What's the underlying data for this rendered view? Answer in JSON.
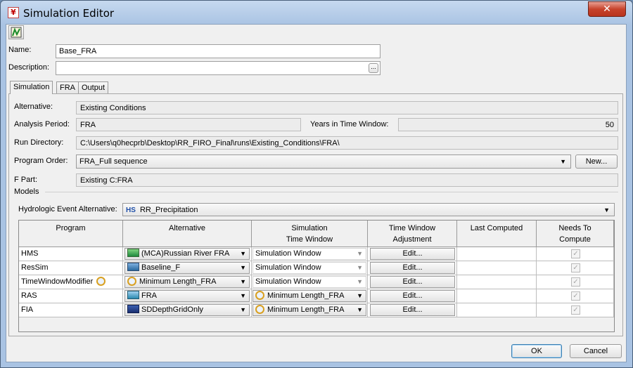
{
  "window": {
    "title": "Simulation Editor",
    "close_label": "✕"
  },
  "form": {
    "name_label": "Name:",
    "name_value": "Base_FRA",
    "description_label": "Description:",
    "description_value": "",
    "browse_label": "..."
  },
  "tabs": [
    {
      "label": "Simulation"
    },
    {
      "label": "FRA"
    },
    {
      "label": "Output"
    }
  ],
  "simulation": {
    "alternative_label": "Alternative:",
    "alternative_value": "Existing Conditions",
    "analysis_period_label": "Analysis Period:",
    "analysis_period_value": "FRA",
    "years_label": "Years in Time Window:",
    "years_value": "50",
    "run_directory_label": "Run Directory:",
    "run_directory_value": "C:\\Users\\q0hecprb\\Desktop\\RR_FIRO_Final\\runs\\Existing_Conditions\\FRA\\",
    "program_order_label": "Program Order:",
    "program_order_value": "FRA_Full sequence",
    "new_button": "New...",
    "fpart_label": "F Part:",
    "fpart_value": "Existing C:FRA",
    "models_label": "Models",
    "hydro_label": "Hydrologic Event Alternative:",
    "hydro_icon_text": "HS",
    "hydro_value": "RR_Precipitation"
  },
  "table": {
    "headers": {
      "program": "Program",
      "alternative": "Alternative",
      "sim_tw_1": "Simulation",
      "sim_tw_2": "Time Window",
      "twa_1": "Time Window",
      "twa_2": "Adjustment",
      "last_computed": "Last Computed",
      "needs_1": "Needs To",
      "needs_2": "Compute"
    },
    "rows": [
      {
        "program": "HMS",
        "alternative": "(MCA)Russian River FRA",
        "time_window": "Simulation Window",
        "adjust": "Edit...",
        "last": "",
        "needs": "✓"
      },
      {
        "program": "ResSim",
        "alternative": "Baseline_F",
        "time_window": "Simulation Window",
        "adjust": "Edit...",
        "last": "",
        "needs": "✓"
      },
      {
        "program": "TimeWindowModifier",
        "alternative": "Minimum Length_FRA",
        "time_window": "Simulation Window",
        "adjust": "Edit...",
        "last": "",
        "needs": "✓"
      },
      {
        "program": "RAS",
        "alternative": "FRA",
        "time_window": "Minimum Length_FRA",
        "adjust": "Edit...",
        "last": "",
        "needs": "✓"
      },
      {
        "program": "FIA",
        "alternative": "SDDepthGridOnly",
        "time_window": "Minimum Length_FRA",
        "adjust": "Edit...",
        "last": "",
        "needs": "✓"
      }
    ]
  },
  "buttons": {
    "ok": "OK",
    "cancel": "Cancel"
  },
  "colors": {
    "title_gradient": "#a9c3e3",
    "close_red": "#c7432c",
    "panel_bg": "#f0f0f0"
  }
}
